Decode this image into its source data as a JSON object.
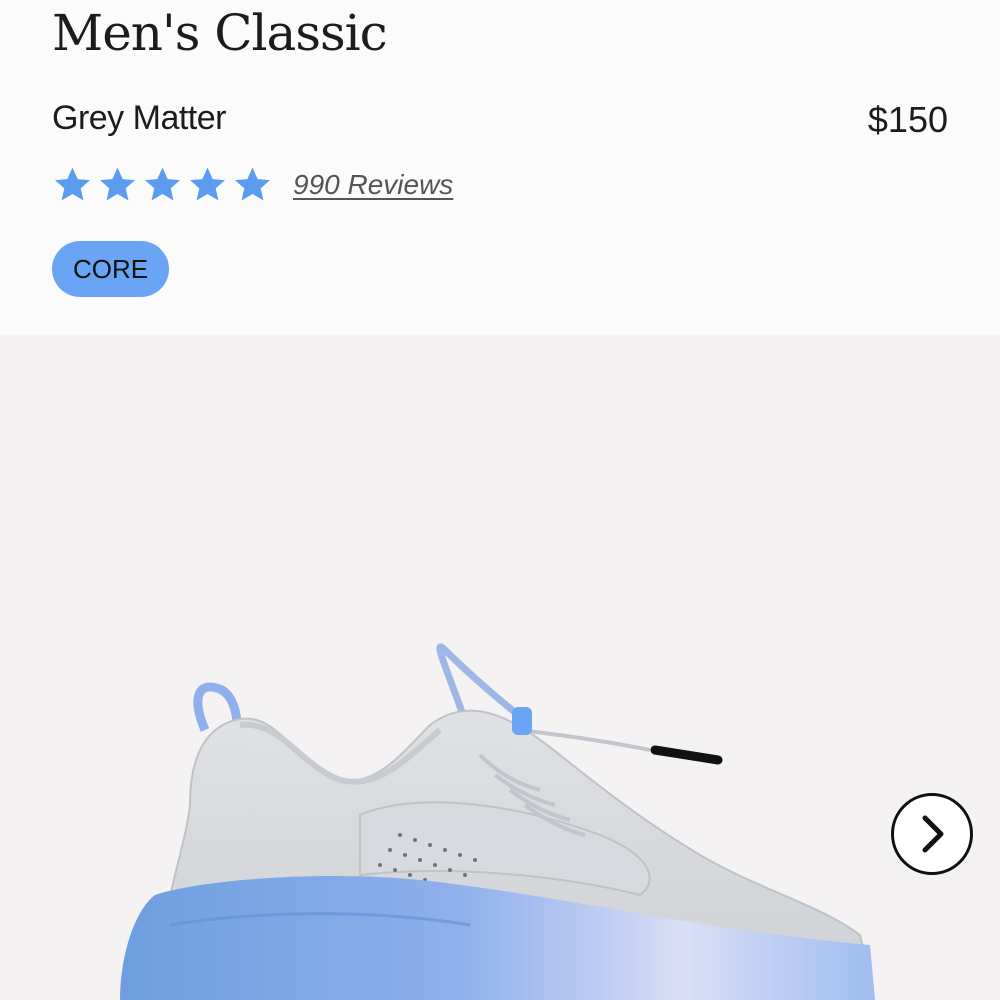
{
  "product": {
    "title": "Men's Classic",
    "colorway": "Grey Matter",
    "price": "$150",
    "rating": 5,
    "reviews_label": "990 Reviews",
    "badge": "CORE"
  },
  "gallery": {
    "image_alt": "Grey Matter sneaker",
    "next_icon": "chevron-right-icon"
  },
  "colors": {
    "accent_blue": "#6aa4f5",
    "star_blue": "#5b9cf0",
    "gallery_bg": "#f5f2f3"
  }
}
